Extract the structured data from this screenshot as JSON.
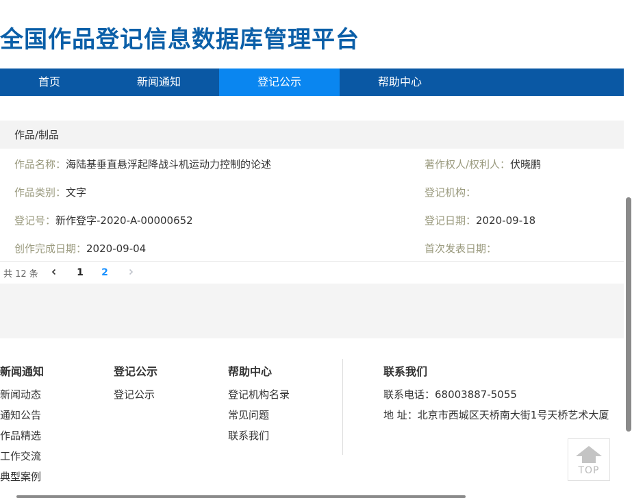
{
  "site": {
    "title": "全国作品登记信息数据库管理平台"
  },
  "nav": {
    "items": [
      {
        "label": "首页"
      },
      {
        "label": "新闻通知"
      },
      {
        "label": "登记公示"
      },
      {
        "label": "帮助中心"
      }
    ],
    "active_index": 2,
    "color": "#0a58a4",
    "active_color": "#0a86f0"
  },
  "record": {
    "section_title": "作品/制品",
    "fields": {
      "work_name": {
        "label": "作品名称：",
        "value": "海陆基垂直悬浮起降战斗机运动力控制的论述"
      },
      "owner": {
        "label": "著作权人/权利人：",
        "value": "伏晓鹏"
      },
      "category": {
        "label": "作品类别：",
        "value": "文字"
      },
      "agency": {
        "label": "登记机构：",
        "value": ""
      },
      "reg_no": {
        "label": "登记号：",
        "value": "新作登字-2020-A-00000652"
      },
      "reg_date": {
        "label": "登记日期：",
        "value": "2020-09-18"
      },
      "done_date": {
        "label": "创作完成日期：",
        "value": "2020-09-04"
      },
      "publish_date": {
        "label": "首次发表日期：",
        "value": ""
      }
    }
  },
  "pager": {
    "total_text": "共 12 条",
    "prev_icon": "chevron-left-icon",
    "next_icon": "chevron-right-icon",
    "pages": [
      "1",
      "2"
    ],
    "current": "2"
  },
  "footer": {
    "columns": [
      {
        "title": "新闻通知",
        "links": [
          "新闻动态",
          "通知公告",
          "作品精选",
          "工作交流",
          "典型案例"
        ]
      },
      {
        "title": "登记公示",
        "links": [
          "登记公示"
        ]
      },
      {
        "title": "帮助中心",
        "links": [
          "登记机构名录",
          "常见问题",
          "联系我们"
        ]
      }
    ],
    "contact": {
      "title": "联系我们",
      "phone": "联系电话：68003887-5055",
      "address": "地 址：北京市西城区天桥南大街1号天桥艺术大厦"
    }
  },
  "back_to_top": {
    "label": "TOP",
    "icon": "arrow-up-house-icon"
  }
}
